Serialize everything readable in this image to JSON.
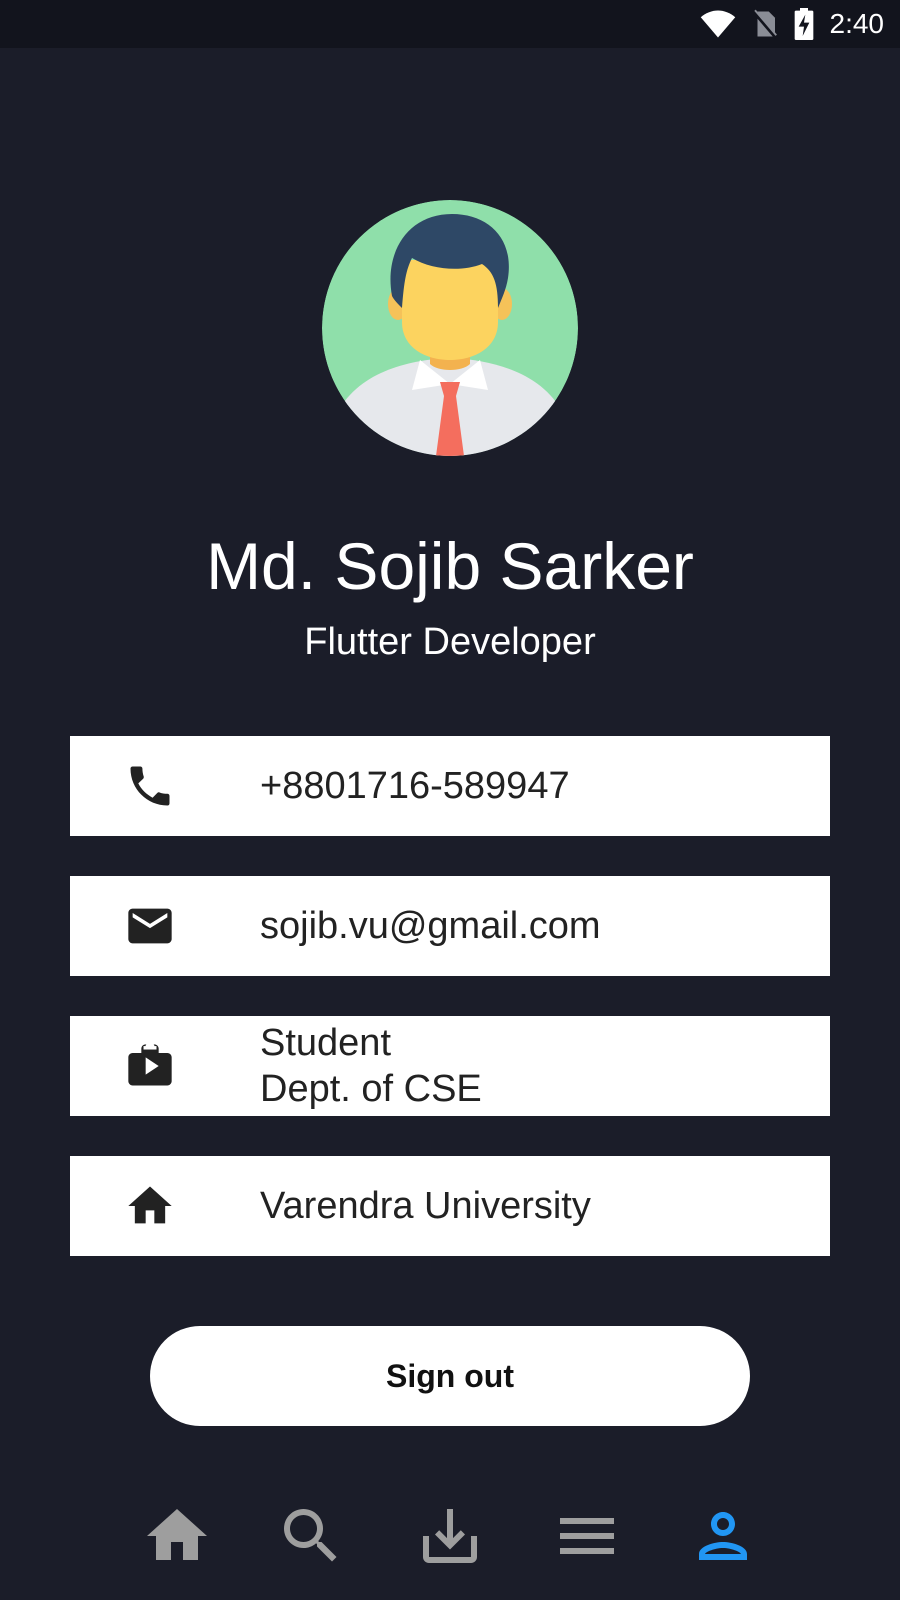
{
  "status_bar": {
    "time": "2:40",
    "icons": [
      "wifi-icon",
      "no-sim-icon",
      "battery-charging-icon"
    ]
  },
  "profile": {
    "avatar": "avatar-illustration",
    "name": "Md. Sojib Sarker",
    "role": "Flutter Developer"
  },
  "info_cards": [
    {
      "icon": "phone-icon",
      "lines": [
        "+8801716-589947"
      ]
    },
    {
      "icon": "email-icon",
      "lines": [
        "sojib.vu@gmail.com"
      ]
    },
    {
      "icon": "work-icon",
      "lines": [
        "Student",
        "Dept. of CSE"
      ]
    },
    {
      "icon": "home-icon",
      "lines": [
        "Varendra University"
      ]
    }
  ],
  "sign_out_label": "Sign out",
  "bottom_nav": {
    "items": [
      "home-icon",
      "search-icon",
      "download-icon",
      "menu-icon",
      "person-icon"
    ],
    "active": "person-icon",
    "active_color": "#2196f3",
    "inactive_color": "#9e9e9e"
  }
}
